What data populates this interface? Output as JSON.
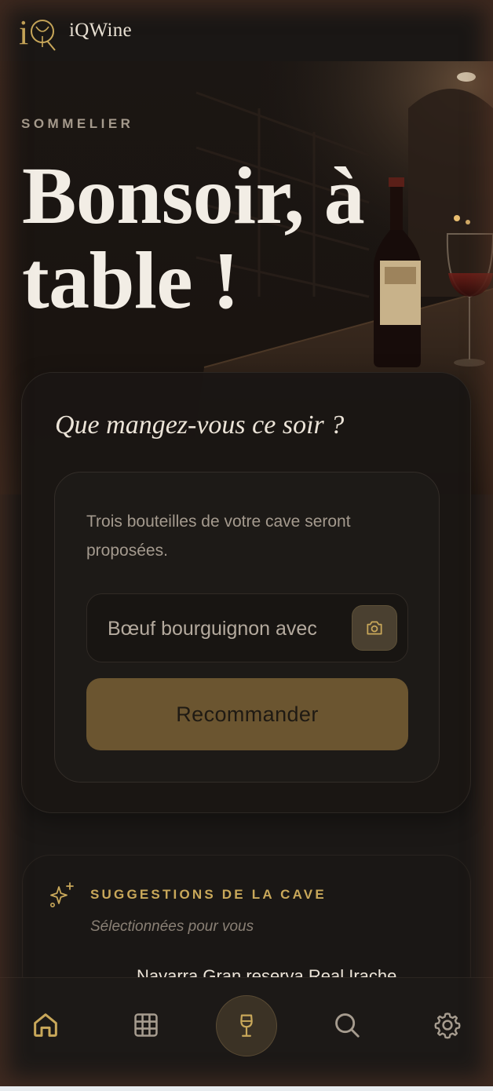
{
  "app": {
    "brand": "iQWine"
  },
  "hero": {
    "eyebrow": "SOMMELIER",
    "title": "Bonsoir, à table !"
  },
  "card": {
    "question": "Que mangez-vous ce soir ?",
    "description": "Trois bouteilles de votre cave seront proposées.",
    "input_value": "Bœuf bourguignon avec",
    "recommend_label": "Recommander"
  },
  "suggestions": {
    "title": "SUGGESTIONS DE LA CAVE",
    "subtitle": "Sélectionnées pour vous",
    "first_item": "Navarra Gran reserva Real Irache"
  },
  "nav": {
    "items": [
      "home-icon",
      "grid-icon",
      "wine-glass-icon",
      "search-icon",
      "gear-icon"
    ],
    "active": "home-icon"
  },
  "colors": {
    "accent": "#c9a85a",
    "background": "#151210",
    "button": "#6b5530"
  }
}
